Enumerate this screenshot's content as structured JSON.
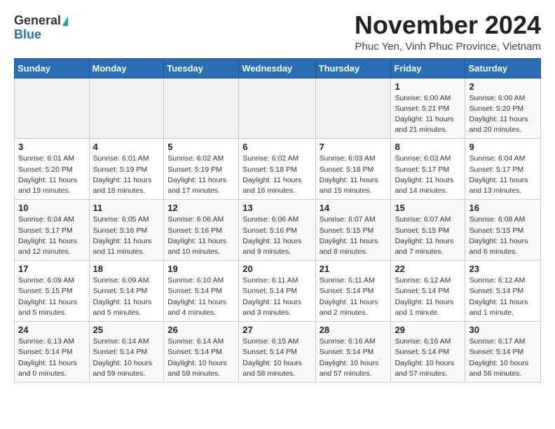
{
  "header": {
    "logo_general": "General",
    "logo_blue": "Blue",
    "month_title": "November 2024",
    "location": "Phuc Yen, Vinh Phuc Province, Vietnam"
  },
  "weekdays": [
    "Sunday",
    "Monday",
    "Tuesday",
    "Wednesday",
    "Thursday",
    "Friday",
    "Saturday"
  ],
  "weeks": [
    [
      {
        "day": "",
        "info": ""
      },
      {
        "day": "",
        "info": ""
      },
      {
        "day": "",
        "info": ""
      },
      {
        "day": "",
        "info": ""
      },
      {
        "day": "",
        "info": ""
      },
      {
        "day": "1",
        "info": "Sunrise: 6:00 AM\nSunset: 5:21 PM\nDaylight: 11 hours\nand 21 minutes."
      },
      {
        "day": "2",
        "info": "Sunrise: 6:00 AM\nSunset: 5:20 PM\nDaylight: 11 hours\nand 20 minutes."
      }
    ],
    [
      {
        "day": "3",
        "info": "Sunrise: 6:01 AM\nSunset: 5:20 PM\nDaylight: 11 hours\nand 19 minutes."
      },
      {
        "day": "4",
        "info": "Sunrise: 6:01 AM\nSunset: 5:19 PM\nDaylight: 11 hours\nand 18 minutes."
      },
      {
        "day": "5",
        "info": "Sunrise: 6:02 AM\nSunset: 5:19 PM\nDaylight: 11 hours\nand 17 minutes."
      },
      {
        "day": "6",
        "info": "Sunrise: 6:02 AM\nSunset: 5:18 PM\nDaylight: 11 hours\nand 16 minutes."
      },
      {
        "day": "7",
        "info": "Sunrise: 6:03 AM\nSunset: 5:18 PM\nDaylight: 11 hours\nand 15 minutes."
      },
      {
        "day": "8",
        "info": "Sunrise: 6:03 AM\nSunset: 5:17 PM\nDaylight: 11 hours\nand 14 minutes."
      },
      {
        "day": "9",
        "info": "Sunrise: 6:04 AM\nSunset: 5:17 PM\nDaylight: 11 hours\nand 13 minutes."
      }
    ],
    [
      {
        "day": "10",
        "info": "Sunrise: 6:04 AM\nSunset: 5:17 PM\nDaylight: 11 hours\nand 12 minutes."
      },
      {
        "day": "11",
        "info": "Sunrise: 6:05 AM\nSunset: 5:16 PM\nDaylight: 11 hours\nand 11 minutes."
      },
      {
        "day": "12",
        "info": "Sunrise: 6:06 AM\nSunset: 5:16 PM\nDaylight: 11 hours\nand 10 minutes."
      },
      {
        "day": "13",
        "info": "Sunrise: 6:06 AM\nSunset: 5:16 PM\nDaylight: 11 hours\nand 9 minutes."
      },
      {
        "day": "14",
        "info": "Sunrise: 6:07 AM\nSunset: 5:15 PM\nDaylight: 11 hours\nand 8 minutes."
      },
      {
        "day": "15",
        "info": "Sunrise: 6:07 AM\nSunset: 5:15 PM\nDaylight: 11 hours\nand 7 minutes."
      },
      {
        "day": "16",
        "info": "Sunrise: 6:08 AM\nSunset: 5:15 PM\nDaylight: 11 hours\nand 6 minutes."
      }
    ],
    [
      {
        "day": "17",
        "info": "Sunrise: 6:09 AM\nSunset: 5:15 PM\nDaylight: 11 hours\nand 5 minutes."
      },
      {
        "day": "18",
        "info": "Sunrise: 6:09 AM\nSunset: 5:14 PM\nDaylight: 11 hours\nand 5 minutes."
      },
      {
        "day": "19",
        "info": "Sunrise: 6:10 AM\nSunset: 5:14 PM\nDaylight: 11 hours\nand 4 minutes."
      },
      {
        "day": "20",
        "info": "Sunrise: 6:11 AM\nSunset: 5:14 PM\nDaylight: 11 hours\nand 3 minutes."
      },
      {
        "day": "21",
        "info": "Sunrise: 6:11 AM\nSunset: 5:14 PM\nDaylight: 11 hours\nand 2 minutes."
      },
      {
        "day": "22",
        "info": "Sunrise: 6:12 AM\nSunset: 5:14 PM\nDaylight: 11 hours\nand 1 minute."
      },
      {
        "day": "23",
        "info": "Sunrise: 6:12 AM\nSunset: 5:14 PM\nDaylight: 11 hours\nand 1 minute."
      }
    ],
    [
      {
        "day": "24",
        "info": "Sunrise: 6:13 AM\nSunset: 5:14 PM\nDaylight: 11 hours\nand 0 minutes."
      },
      {
        "day": "25",
        "info": "Sunrise: 6:14 AM\nSunset: 5:14 PM\nDaylight: 10 hours\nand 59 minutes."
      },
      {
        "day": "26",
        "info": "Sunrise: 6:14 AM\nSunset: 5:14 PM\nDaylight: 10 hours\nand 59 minutes."
      },
      {
        "day": "27",
        "info": "Sunrise: 6:15 AM\nSunset: 5:14 PM\nDaylight: 10 hours\nand 58 minutes."
      },
      {
        "day": "28",
        "info": "Sunrise: 6:16 AM\nSunset: 5:14 PM\nDaylight: 10 hours\nand 57 minutes."
      },
      {
        "day": "29",
        "info": "Sunrise: 6:16 AM\nSunset: 5:14 PM\nDaylight: 10 hours\nand 57 minutes."
      },
      {
        "day": "30",
        "info": "Sunrise: 6:17 AM\nSunset: 5:14 PM\nDaylight: 10 hours\nand 56 minutes."
      }
    ]
  ]
}
